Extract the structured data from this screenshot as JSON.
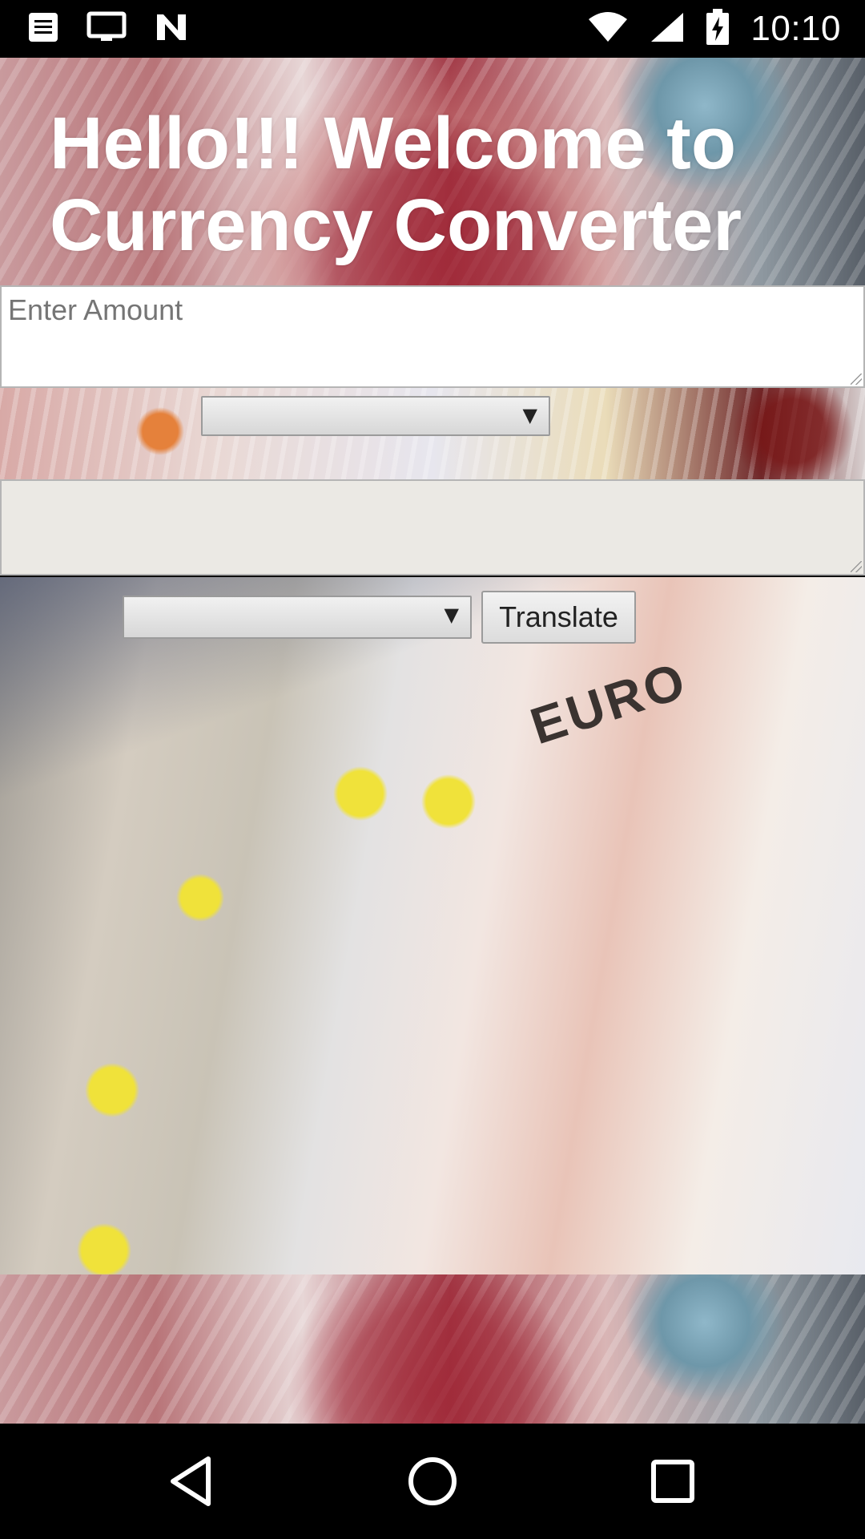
{
  "status_bar": {
    "time": "10:10",
    "icons": [
      "notes-icon",
      "monitor-icon",
      "n-app-icon",
      "wifi-icon",
      "signal-icon",
      "battery-charging-icon"
    ]
  },
  "app": {
    "title": "Hello!!! Welcome to Currency Converter",
    "amount_input": {
      "placeholder": "Enter Amount",
      "value": ""
    },
    "from_currency_select": {
      "selected": ""
    },
    "result_output": {
      "value": ""
    },
    "to_currency_select": {
      "selected": ""
    },
    "translate_button_label": "Translate"
  },
  "background": {
    "banknote_text": "EURO"
  },
  "nav_bar": {
    "buttons": [
      "back-icon",
      "home-icon",
      "recents-icon"
    ]
  }
}
